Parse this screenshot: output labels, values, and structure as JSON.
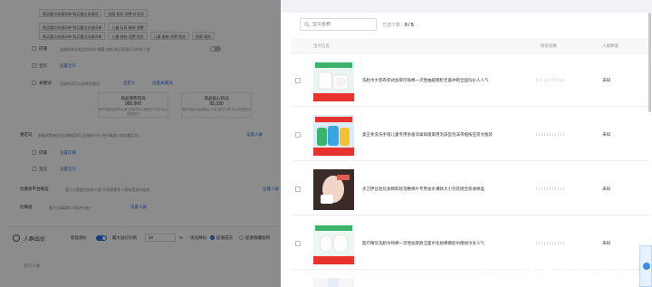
{
  "background": {
    "tag_rows": [
      [
        "购买重点关键词单·购买重点关键词",
        "衣服 相关 消费 补充词"
      ],
      [
        "购买重点关键词单·购买重点关键词单",
        "儿童 玩具 服装 消费"
      ],
      [
        "购买重点关键词单·购买重点关键词单",
        "儿童 服装 消费 相关",
        "儿童 服装 消费 相关",
        "搜索 相关"
      ]
    ],
    "rows": [
      {
        "label": "店铺",
        "text": "店铺如果对商品的浏览·收藏·加购·购买等进行分析的人群"
      },
      {
        "label": "宝贝",
        "link": "设置宝贝"
      },
      {
        "label": "关键词",
        "text": "投放的词可以选择关键词",
        "link": "自定义",
        "link2": "设置关键词"
      }
    ],
    "cards": [
      {
        "title": "商品潜客热词",
        "value": "985,900",
        "desc": "基于商品对热词人群·店铺中的人群进行分析·可以选择进行"
      },
      {
        "title": "商品核心热词",
        "value": "95,330",
        "desc": "基于商品对店铺核心人群·进行计算·可以投放进行"
      }
    ],
    "section_label": "重定向",
    "section_text": "根据消费者在您店铺或同行·店铺的行为·进行精准人群的重定向·",
    "section_link": "设置人群",
    "sub_rows": [
      {
        "label": "店铺",
        "link": "设置店铺"
      },
      {
        "label": "宝贝",
        "link": "设置宝贝"
      },
      {
        "label": "宝贝",
        "link": "设置宝贝"
      }
    ],
    "platform_label": "达摩盘平台精选",
    "platform_text": "基于大数据分析的人群·可选择更多人群标签进行组合",
    "platform_link": "设置人群",
    "damo_label": "达摩盘",
    "damo_text": "基于达摩盘的人群进行推广",
    "damo_link": "设置人群",
    "bid_title": "人群出价",
    "bid_toggle_label": "智能调价",
    "bid_premium_label": "最大溢价比例",
    "bid_premium_value": "30",
    "bid_percent": "%",
    "bid_opt_label": "优化目标",
    "bid_opt_1": "促进成交",
    "bid_opt_2": "促进收藏加购",
    "bid_col": "定向人群"
  },
  "drawer": {
    "search_placeholder": "宝贝名称",
    "selected_label": "已选个数：",
    "selected_value": "0 / 5",
    "columns": {
      "product": "宝贝信息",
      "score": "搜索指数",
      "crowd": "人群数量"
    },
    "items": [
      {
        "name": "洗脸巾大卷卷卷式加厚珍珠棉一次性抽取擦脸无菌冲刺全国均价人人气",
        "score_bar": true,
        "crowd": "未知",
        "banner": "已售 一 爆款一件"
      },
      {
        "name": "奥王免洗洗手液儿童专用杀菌消毒抑菌家用泡沫型泡沫带瓶按压装大瓶装",
        "score_bar": true,
        "crowd": "未知",
        "banner": "已售 一 爆款一件"
      },
      {
        "name": "水刀伊豆粒化妆棉卸妆湿敷棉片专用省水薄款大小包装组合装收纳盒",
        "score_bar": true,
        "crowd": "未知",
        "banner": ""
      },
      {
        "name": "医疗精华洗脸巾纯棉一次性加厚款洁面巾化妆棉擦脸巾擦拭巾女人气",
        "score_bar": true,
        "crowd": "未知",
        "banner": "已售 一 爆款一件"
      }
    ]
  },
  "watermark": "知乎 @淘宝人远航",
  "colors": {
    "accent": "#2f6fe0",
    "overlay": "rgba(0,0,0,0.45)",
    "drawer_header": "#f0f2f5",
    "product_banner_red": "#e8322d",
    "product_green": "#3bb36a"
  }
}
